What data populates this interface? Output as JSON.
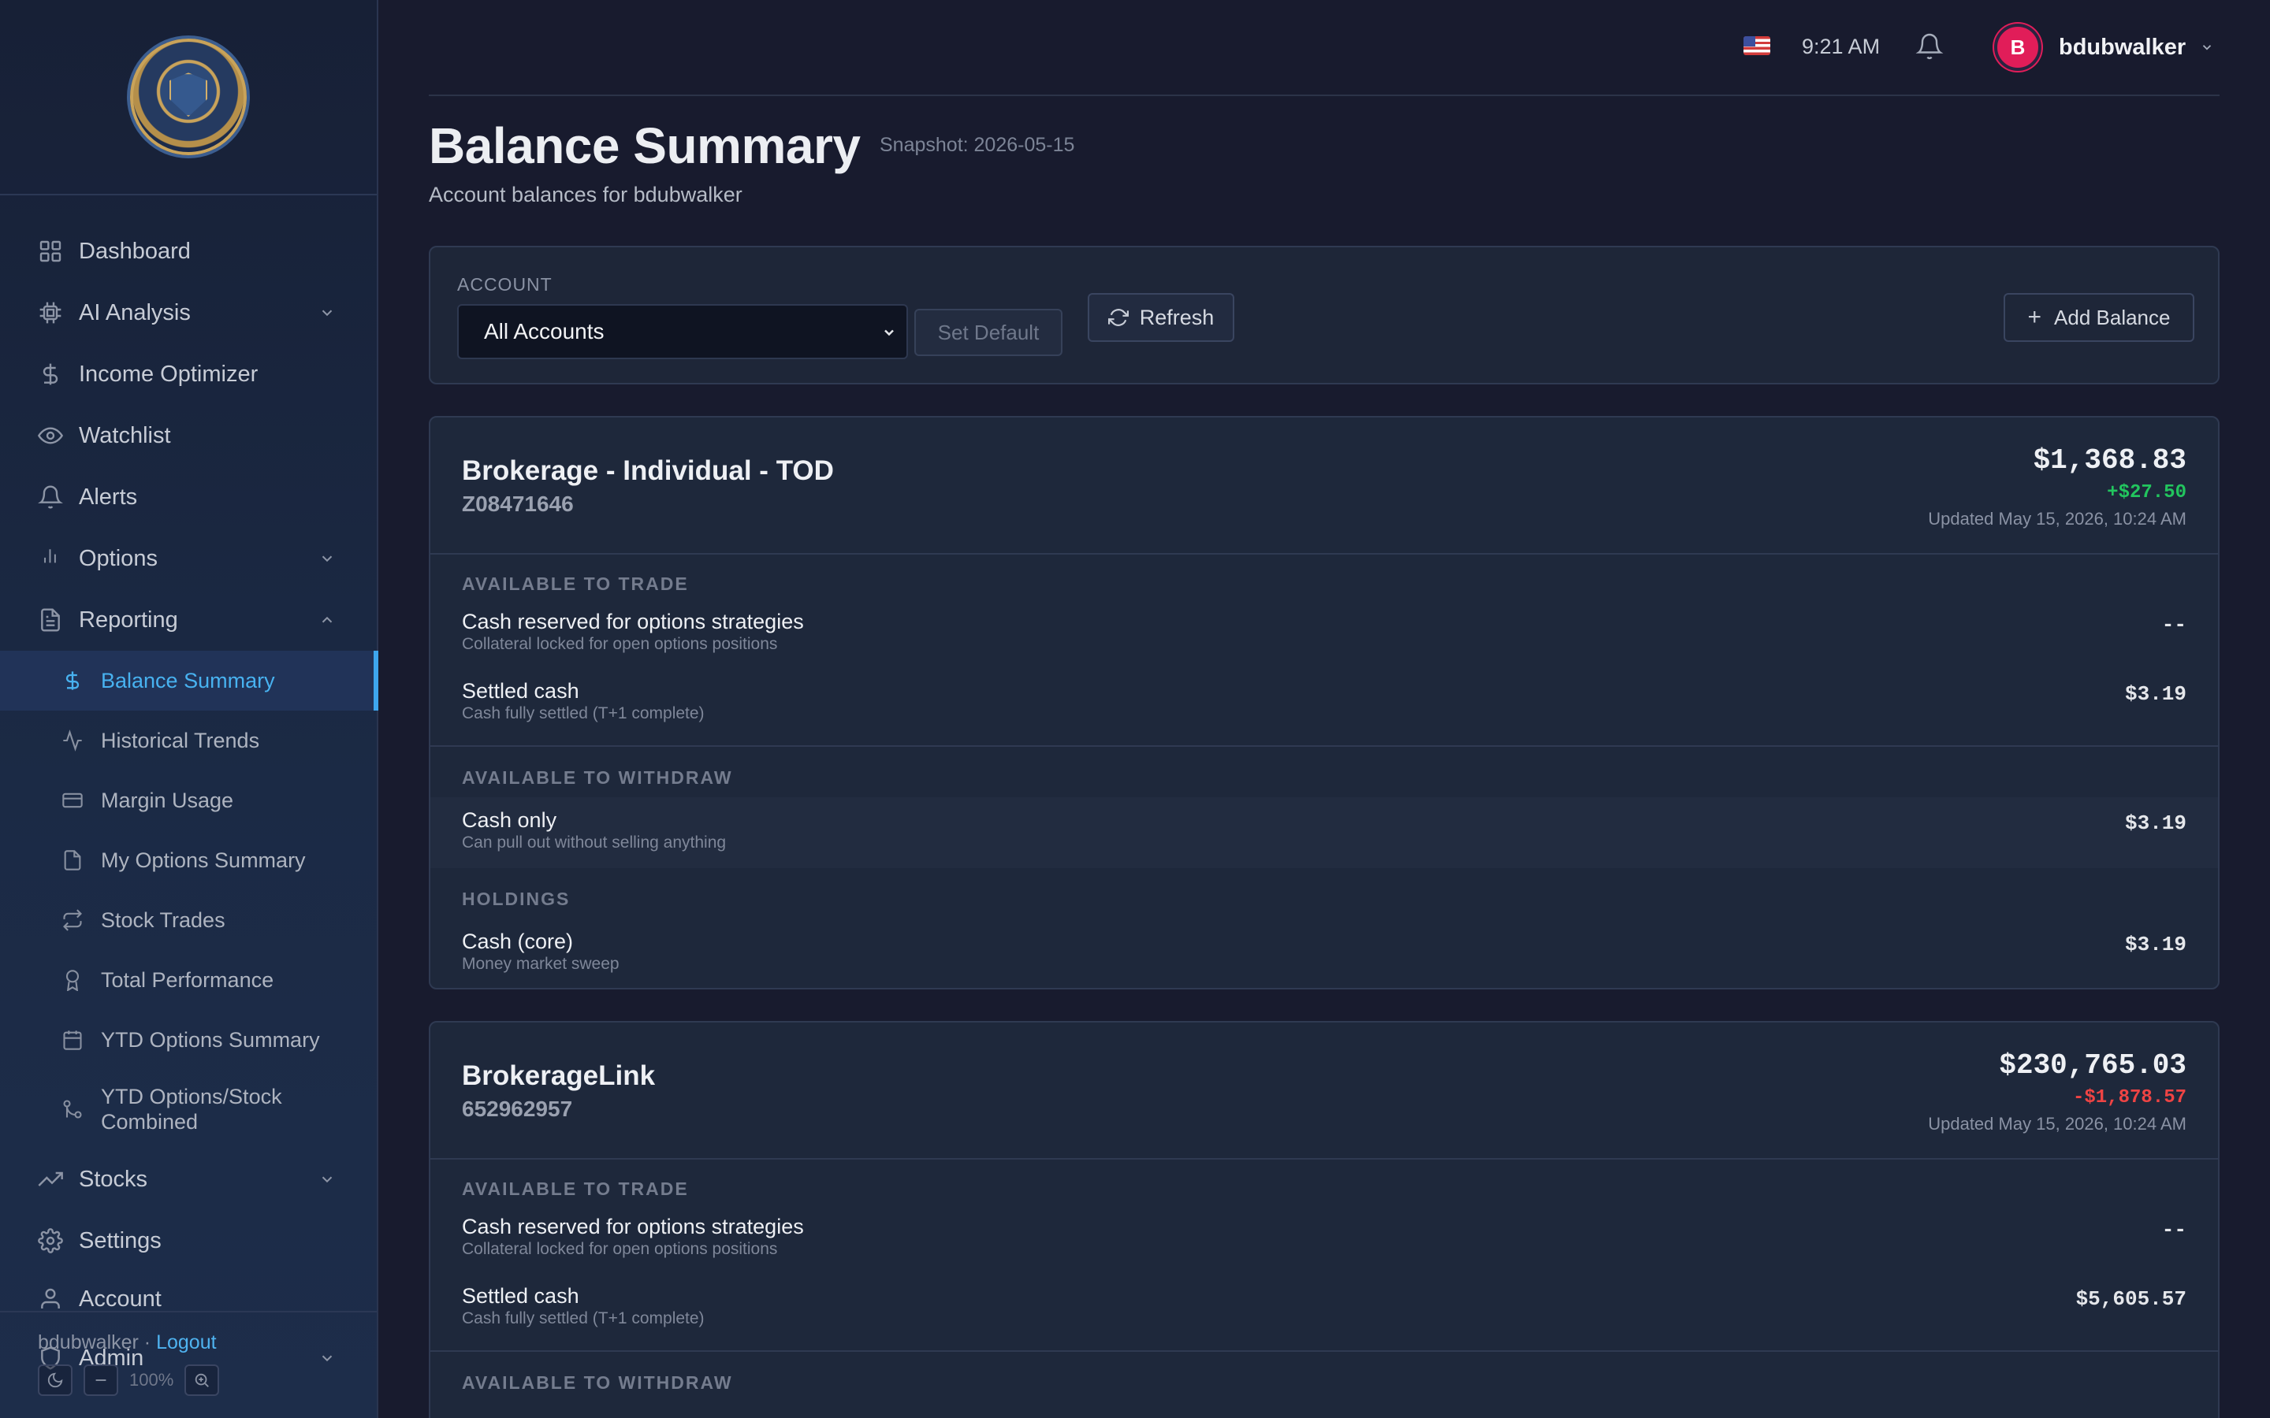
{
  "sidebar": {
    "logo_text": "OPTIONS ANALYTICS PLATFORM · OPTIONLOGIC · SECURE GROWTH",
    "items": [
      {
        "label": "Dashboard",
        "icon": "grid-icon"
      },
      {
        "label": "AI Analysis",
        "icon": "chip-icon",
        "expandable": true
      },
      {
        "label": "Income Optimizer",
        "icon": "dollar-icon"
      },
      {
        "label": "Watchlist",
        "icon": "eye-icon"
      },
      {
        "label": "Alerts",
        "icon": "bell-icon"
      },
      {
        "label": "Options",
        "icon": "bar-chart-icon",
        "expandable": true
      },
      {
        "label": "Reporting",
        "icon": "document-icon",
        "expanded": true
      }
    ],
    "reporting_sub": [
      {
        "label": "Balance Summary",
        "icon": "dollar-icon",
        "active": true
      },
      {
        "label": "Historical Trends",
        "icon": "activity-icon"
      },
      {
        "label": "Margin Usage",
        "icon": "credit-card-icon"
      },
      {
        "label": "My Options Summary",
        "icon": "file-icon"
      },
      {
        "label": "Stock Trades",
        "icon": "swap-icon"
      },
      {
        "label": "Total Performance",
        "icon": "award-icon"
      },
      {
        "label": "YTD Options Summary",
        "icon": "calendar-icon"
      },
      {
        "label": "YTD Options/Stock Combined",
        "icon": "git-merge-icon"
      }
    ],
    "items_after": [
      {
        "label": "Stocks",
        "icon": "trending-up-icon",
        "expandable": true
      },
      {
        "label": "Settings",
        "icon": "gear-icon"
      },
      {
        "label": "Account",
        "icon": "user-icon"
      },
      {
        "label": "Admin",
        "icon": "shield-icon",
        "expandable": true
      }
    ],
    "footer": {
      "user": "bdubwalker ·",
      "logout": "Logout",
      "zoom": "100%"
    }
  },
  "topbar": {
    "time": "9:21 AM",
    "username": "bdubwalker",
    "avatar_initial": "B"
  },
  "header": {
    "title": "Balance Summary",
    "snapshot": "Snapshot: 2026-05-15",
    "subtitle": "Account balances for bdubwalker"
  },
  "filter": {
    "account_label": "ACCOUNT",
    "account_value": "All Accounts",
    "set_default": "Set Default",
    "refresh": "Refresh",
    "add_balance": "Add Balance"
  },
  "accounts": [
    {
      "name": "Brokerage - Individual - TOD",
      "number": "Z08471646",
      "total": "$1,368.83",
      "change": "+$27.50",
      "change_dir": "pos",
      "updated": "Updated May 15, 2026, 10:24 AM",
      "sections": [
        {
          "title": "AVAILABLE TO TRADE",
          "rows": [
            {
              "label": "Cash reserved for options strategies",
              "desc": "Collateral locked for open options positions",
              "value": "--"
            },
            {
              "label": "Settled cash",
              "desc": "Cash fully settled (T+1 complete)",
              "value": "$3.19"
            }
          ]
        },
        {
          "title": "AVAILABLE TO WITHDRAW",
          "rows": [
            {
              "label": "Cash only",
              "desc": "Can pull out without selling anything",
              "value": "$3.19"
            }
          ]
        },
        {
          "title": "HOLDINGS",
          "rows": [
            {
              "label": "Cash (core)",
              "desc": "Money market sweep",
              "value": "$3.19"
            }
          ]
        }
      ]
    },
    {
      "name": "BrokerageLink",
      "number": "652962957",
      "total": "$230,765.03",
      "change": "-$1,878.57",
      "change_dir": "neg",
      "updated": "Updated May 15, 2026, 10:24 AM",
      "sections": [
        {
          "title": "AVAILABLE TO TRADE",
          "rows": [
            {
              "label": "Cash reserved for options strategies",
              "desc": "Collateral locked for open options positions",
              "value": "--"
            },
            {
              "label": "Settled cash",
              "desc": "Cash fully settled (T+1 complete)",
              "value": "$5,605.57"
            }
          ]
        },
        {
          "title": "AVAILABLE TO WITHDRAW",
          "rows": []
        }
      ]
    }
  ],
  "colors": {
    "accent": "#48b2f0",
    "positive": "#22c55e",
    "negative": "#ef4444",
    "avatar": "#e11d59"
  }
}
